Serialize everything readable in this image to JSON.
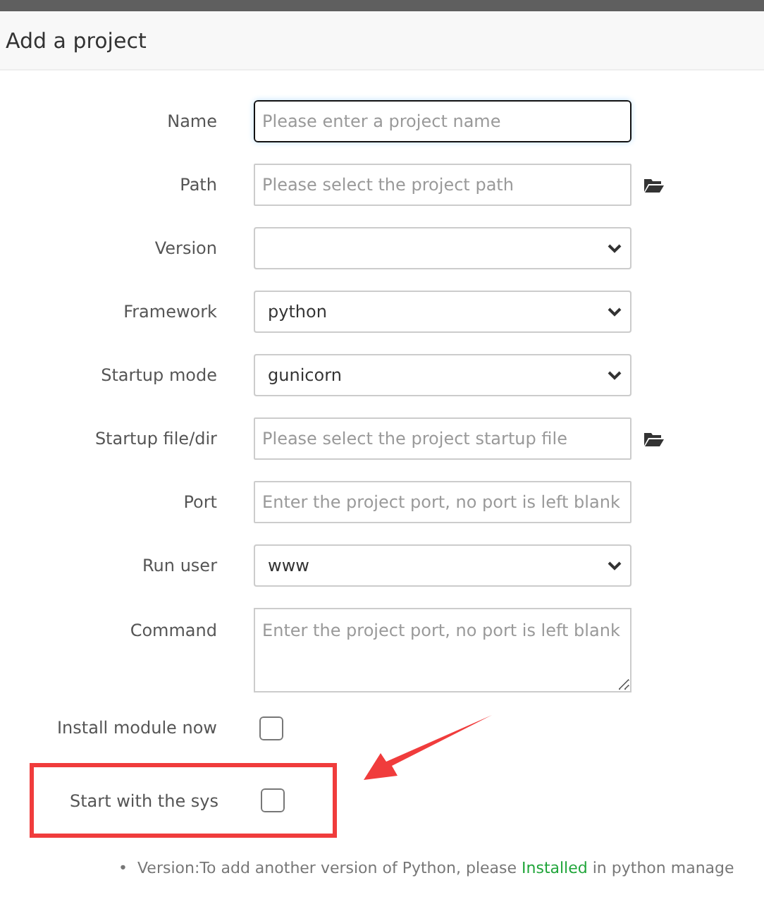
{
  "dialog": {
    "title": "Add a project"
  },
  "fields": [
    {
      "kind": "text",
      "label": "Name",
      "placeholder": "Please enter a project name",
      "focused": true,
      "browse": false
    },
    {
      "kind": "text",
      "label": "Path",
      "placeholder": "Please select the project path",
      "focused": false,
      "browse": true
    },
    {
      "kind": "select",
      "label": "Version"
    },
    {
      "kind": "select",
      "label": "Framework",
      "value": "python"
    },
    {
      "kind": "select",
      "label": "Startup mode",
      "value": "gunicorn"
    },
    {
      "kind": "text",
      "label": "Startup file/dir",
      "placeholder": "Please select the project startup file",
      "focused": false,
      "browse": true
    },
    {
      "kind": "text",
      "label": "Port",
      "placeholder": "Enter the project port, no port is left blank",
      "focused": false,
      "browse": false
    },
    {
      "kind": "select",
      "label": "Run user",
      "value": "www"
    },
    {
      "kind": "textarea",
      "label": "Command",
      "placeholder": "Enter the project port, no port is left blank"
    },
    {
      "kind": "checkbox",
      "label": "Install module now",
      "checked": false,
      "highlighted": false
    },
    {
      "kind": "checkbox",
      "label": "Start with the sys",
      "checked": false,
      "highlighted": true
    }
  ],
  "notes": [
    {
      "bullet": "•",
      "text": "Version:To add another version of Python, please **Installed** in python manage"
    }
  ]
}
